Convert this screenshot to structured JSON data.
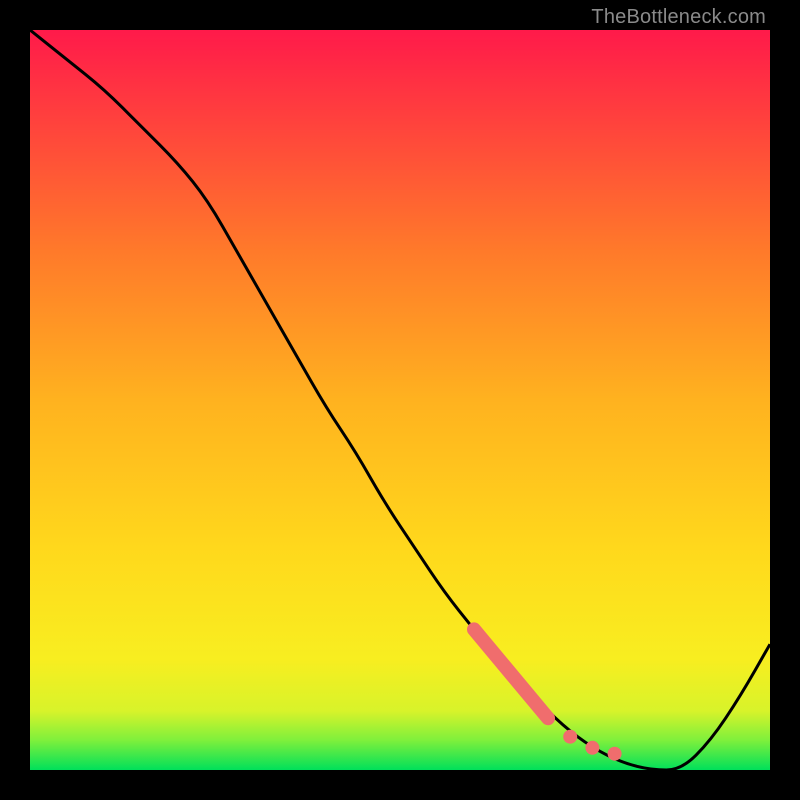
{
  "attribution": "TheBottleneck.com",
  "chart_data": {
    "type": "line",
    "title": "",
    "xlabel": "",
    "ylabel": "",
    "xlim": [
      0,
      100
    ],
    "ylim": [
      0,
      100
    ],
    "background_gradient": {
      "stops": [
        {
          "pos": 0.0,
          "color": "#00e05a"
        },
        {
          "pos": 0.04,
          "color": "#7ef03c"
        },
        {
          "pos": 0.08,
          "color": "#d8f32a"
        },
        {
          "pos": 0.15,
          "color": "#f8ee20"
        },
        {
          "pos": 0.3,
          "color": "#ffd81c"
        },
        {
          "pos": 0.5,
          "color": "#ffb21f"
        },
        {
          "pos": 0.7,
          "color": "#ff7a2a"
        },
        {
          "pos": 0.85,
          "color": "#ff4a3a"
        },
        {
          "pos": 1.0,
          "color": "#ff1a4a"
        }
      ]
    },
    "series": [
      {
        "name": "bottleneck-curve",
        "color": "#000000",
        "x": [
          0,
          5,
          10,
          15,
          20,
          24,
          28,
          32,
          36,
          40,
          44,
          48,
          52,
          56,
          60,
          64,
          68,
          72,
          76,
          80,
          84,
          88,
          92,
          96,
          100
        ],
        "y": [
          100,
          96,
          92,
          87,
          82,
          77,
          70,
          63,
          56,
          49,
          43,
          36,
          30,
          24,
          19,
          14,
          10,
          6,
          3,
          1,
          0,
          0,
          4,
          10,
          17
        ]
      }
    ],
    "markers": [
      {
        "name": "highlight-segment",
        "type": "thick-line",
        "color": "#f06d6d",
        "x": [
          60,
          70
        ],
        "y": [
          19,
          7
        ]
      },
      {
        "name": "highlight-dots",
        "type": "dots",
        "color": "#f06d6d",
        "points": [
          {
            "x": 73,
            "y": 4.5
          },
          {
            "x": 76,
            "y": 3.0
          },
          {
            "x": 79,
            "y": 2.2
          }
        ]
      }
    ]
  }
}
